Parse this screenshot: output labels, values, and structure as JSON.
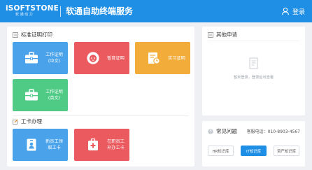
{
  "header": {
    "logo_brand": "iSOFTSTONE",
    "logo_sub": "软 通 动 力",
    "title": "软通自助终端服务",
    "login_label": "登录",
    "login_icon": "user-icon",
    "bg_color": "#1f8fe6"
  },
  "main": {
    "section_cert": {
      "title": "标准证明打印",
      "icon": "document-icon",
      "tiles": [
        {
          "label_line1": "工作证明",
          "label_line2": "(中文)",
          "color": "#4aa3ea",
          "icon": "briefcase-icon"
        },
        {
          "label_line1": "暂育证明",
          "label_line2": "",
          "color": "#ea5a5e",
          "icon": "baby-icon"
        },
        {
          "label_line1": "实习证明",
          "label_line2": "",
          "color": "#f2ac3a",
          "icon": "certificate-icon"
        },
        {
          "label_line1": "工作证明",
          "label_line2": "(英文)",
          "color": "#4fcb86",
          "icon": "briefcase-icon"
        }
      ]
    },
    "section_badge": {
      "title": "工卡办理",
      "icon": "edit-icon",
      "tiles": [
        {
          "label_line1": "新员工领",
          "label_line2": "取工卡",
          "color": "#4aa3ea",
          "icon": "badge-icon"
        },
        {
          "label_line1": "在职员工",
          "label_line2": "补办工卡",
          "color": "#ea5a5e",
          "icon": "medical-kit-icon"
        }
      ]
    }
  },
  "other": {
    "title": "其他申请",
    "icon": "document-icon",
    "empty_icon": "empty-document-icon",
    "empty_text": "暂未登录，登录后可查看"
  },
  "faq": {
    "title": "常见问题",
    "icon": "question-icon",
    "phone_label": "客服电话：",
    "phone": "010-8903-4567",
    "buttons": [
      {
        "label": "HR知识库",
        "active": false
      },
      {
        "label": "IT知识库",
        "active": true
      },
      {
        "label": "资产知识库",
        "active": false
      }
    ]
  }
}
